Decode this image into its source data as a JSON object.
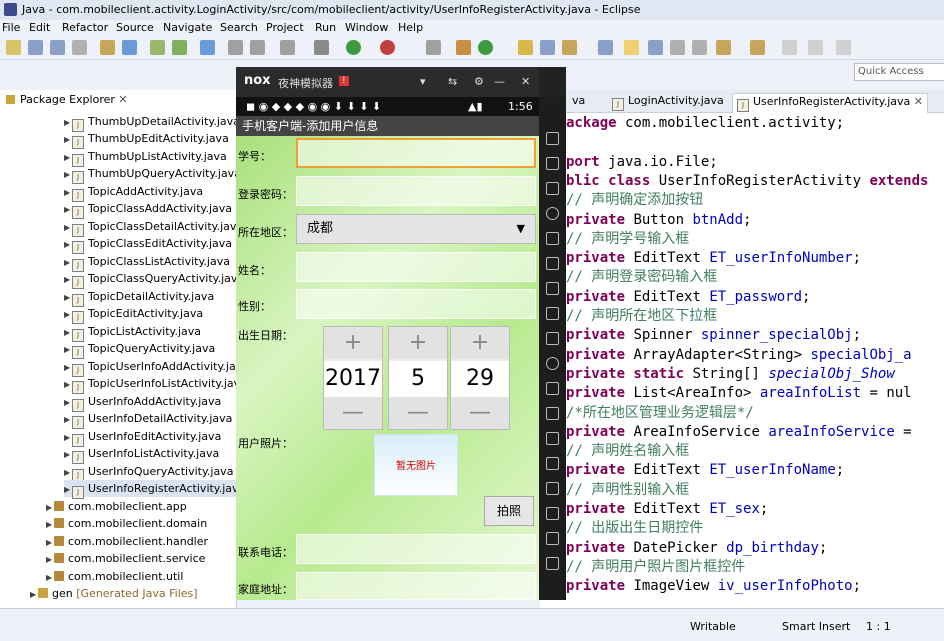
{
  "window": {
    "title": "Java - com.mobileclient.activity.LoginActivity/src/com/mobileclient/activity/UserInfoRegisterActivity.java - Eclipse"
  },
  "menu": [
    "File",
    "Edit",
    "Refactor",
    "Source",
    "Navigate",
    "Search",
    "Project",
    "Run",
    "Window",
    "Help"
  ],
  "quick_access": {
    "placeholder": "Quick Access"
  },
  "package_explorer": {
    "tab_label": "Package Explorer",
    "files": [
      "ThumbUpDetailActivity.java",
      "ThumbUpEditActivity.java",
      "ThumbUpListActivity.java",
      "ThumbUpQueryActivity.java",
      "TopicAddActivity.java",
      "TopicClassAddActivity.java",
      "TopicClassDetailActivity.java",
      "TopicClassEditActivity.java",
      "TopicClassListActivity.java",
      "TopicClassQueryActivity.java",
      "TopicDetailActivity.java",
      "TopicEditActivity.java",
      "TopicListActivity.java",
      "TopicQueryActivity.java",
      "TopicUserInfoAddActivity.java",
      "TopicUserInfoListActivity.java",
      "UserInfoAddActivity.java",
      "UserInfoDetailActivity.java",
      "UserInfoEditActivity.java",
      "UserInfoListActivity.java",
      "UserInfoQueryActivity.java",
      "UserInfoRegisterActivity.java"
    ],
    "packages": [
      "com.mobileclient.app",
      "com.mobileclient.domain",
      "com.mobileclient.handler",
      "com.mobileclient.service",
      "com.mobileclient.util"
    ],
    "gen": {
      "name": "gen",
      "note": "[Generated Java Files]"
    }
  },
  "editor": {
    "tabs": [
      "va",
      "LoginActivity.java",
      "UserInfoRegisterActivity.java"
    ],
    "lines": [
      [
        "kw:ackage",
        "t: com.mobileclient.activity;"
      ],
      [],
      [
        "kw:port",
        "t: java.io.File;"
      ],
      [
        "kw:blic class",
        "t: UserInfoRegisterActivity ",
        "kw:extends"
      ],
      [
        "t:    ",
        "cm:// 声明确定添加按钮"
      ],
      [
        "t:    ",
        "kw:private",
        "t: Button ",
        "fld:btnAdd",
        "t:;"
      ],
      [
        "t:    ",
        "cm:// 声明学号输入框"
      ],
      [
        "t:    ",
        "kw:private",
        "t: EditText ",
        "fld:ET_userInfoNumber",
        "t:;"
      ],
      [
        "t:    ",
        "cm:// 声明登录密码输入框"
      ],
      [
        "t:    ",
        "kw:private",
        "t: EditText ",
        "fld:ET_password",
        "t:;"
      ],
      [
        "t:    ",
        "cm:// 声明所在地区下拉框"
      ],
      [
        "t:    ",
        "kw:private",
        "t: Spinner ",
        "fld:spinner_specialObj",
        "t:;"
      ],
      [
        "t:    ",
        "kw:private",
        "t: ArrayAdapter<String> ",
        "fld:specialObj_a"
      ],
      [
        "t:    ",
        "kw:private static",
        "t:  String[] ",
        "it:specialObj_Show"
      ],
      [
        "t:    ",
        "kw:private",
        "t: List<AreaInfo> ",
        "fld:areaInfoList",
        "t: = nul"
      ],
      [
        "t:    ",
        "cm:/*所在地区管理业务逻辑层*/"
      ],
      [
        "t:    ",
        "kw:private",
        "t: AreaInfoService ",
        "fld:areaInfoService",
        "t: ="
      ],
      [
        "t:    ",
        "cm:// 声明姓名输入框"
      ],
      [
        "t:    ",
        "kw:private",
        "t: EditText ",
        "fld:ET_userInfoName",
        "t:;"
      ],
      [
        "t:    ",
        "cm:// 声明性别输入框"
      ],
      [
        "t:    ",
        "kw:private",
        "t: EditText ",
        "fld:ET_sex",
        "t:;"
      ],
      [
        "t:    ",
        "cm:// 出版出生日期控件"
      ],
      [
        "t:    ",
        "kw:private",
        "t: DatePicker ",
        "fld:dp_birthday",
        "t:;"
      ],
      [
        "t:    ",
        "cm:// 声明用户照片图片框控件"
      ],
      [
        "t:    ",
        "kw:private",
        "t: ImageView ",
        "fld:iv_userInfoPhoto",
        "t:;"
      ]
    ]
  },
  "status": {
    "writable": "Writable",
    "insert": "Smart Insert",
    "position": "1 : 1"
  },
  "emulator": {
    "brand": "nox",
    "name": "夜神模拟器",
    "badge": "!",
    "time": "1:56",
    "app_title": "手机客户端-添加用户信息",
    "labels": {
      "number": "学号：",
      "password": "登录密码：",
      "area": "所在地区：",
      "name": "姓名：",
      "sex": "性别：",
      "birthday": "出生日期：",
      "photo": "用户照片：",
      "phone": "联系电话：",
      "address": "家庭地址："
    },
    "area_value": "成都",
    "date": {
      "year": "2017",
      "month": "5",
      "day": "29"
    },
    "photo_placeholder": "暂无图片",
    "photo_button": "拍照"
  }
}
